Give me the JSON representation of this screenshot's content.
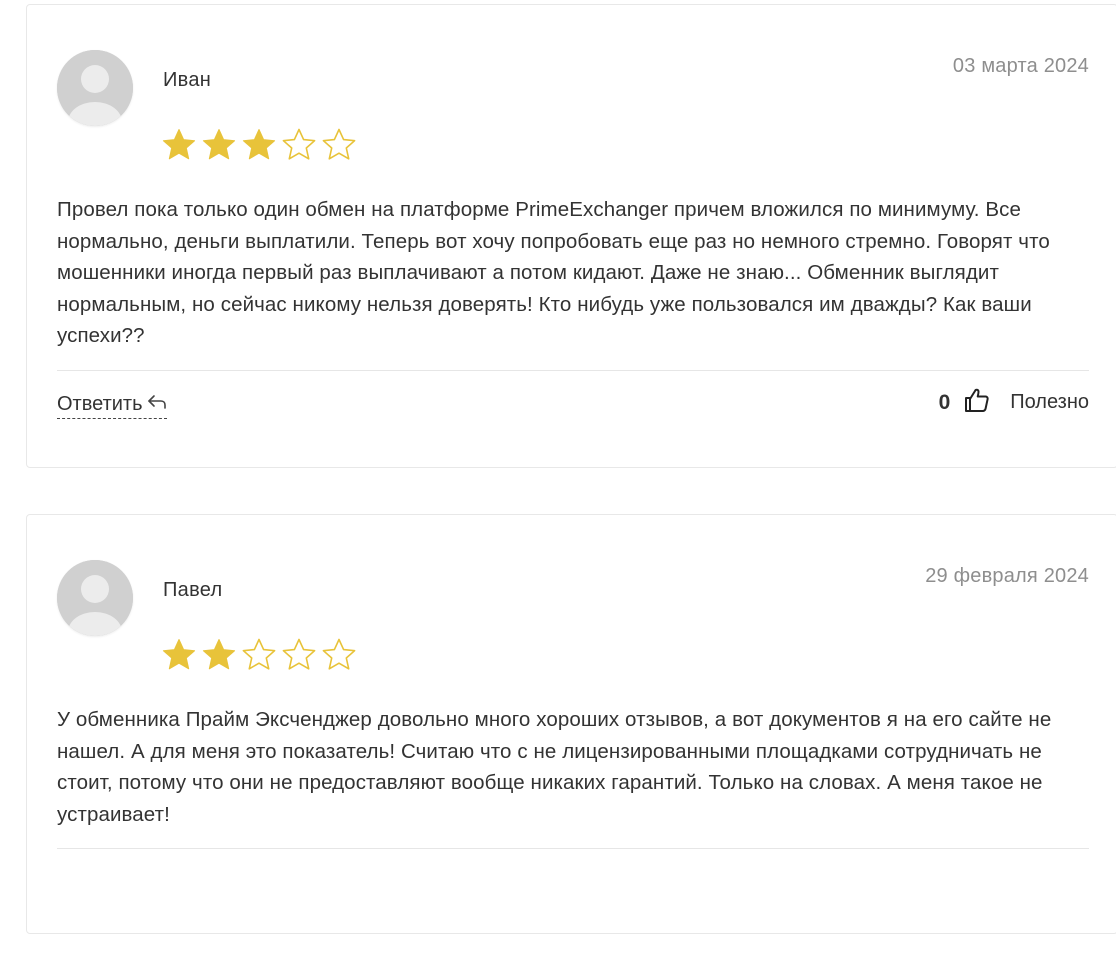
{
  "reviews": [
    {
      "author": "Иван",
      "date": "03 марта 2024",
      "rating": 3,
      "max_rating": 5,
      "text": "Провел пока только один обмен на платформе PrimeExchanger причем вложился по минимуму. Все нормально, деньги выплатили. Теперь вот хочу попробовать еще раз но немного стремно. Говорят что мошенники иногда первый раз выплачивают а потом кидают. Даже не знаю... Обменник выглядит нормальным, но сейчас никому нельзя доверять! Кто нибудь уже пользовался им дважды? Как ваши успехи??",
      "reply_label": "Ответить",
      "useful_count": "0",
      "useful_label": "Полезно"
    },
    {
      "author": "Павел",
      "date": "29 февраля 2024",
      "rating": 2,
      "max_rating": 5,
      "text": "У обменника Прайм Эксченджер довольно много хороших отзывов, а вот документов я на его сайте не нашел. А для меня это показатель! Считаю что с не лицензированными площадками сотрудничать не стоит, потому что они не предоставляют вообще никаких гарантий. Только на словах. А меня такое не устраивает!"
    }
  ],
  "colors": {
    "star_filled": "#E8C33A",
    "star_outline": "#E8C33A",
    "date_text": "#8E8E8E",
    "card_border": "#E8E8E8",
    "avatar_bg": "#D2D2D2"
  },
  "icons": {
    "avatar": "user-silhouette-icon",
    "star": "star-icon",
    "reply": "reply-arrow-icon",
    "like": "thumbs-up-icon"
  }
}
